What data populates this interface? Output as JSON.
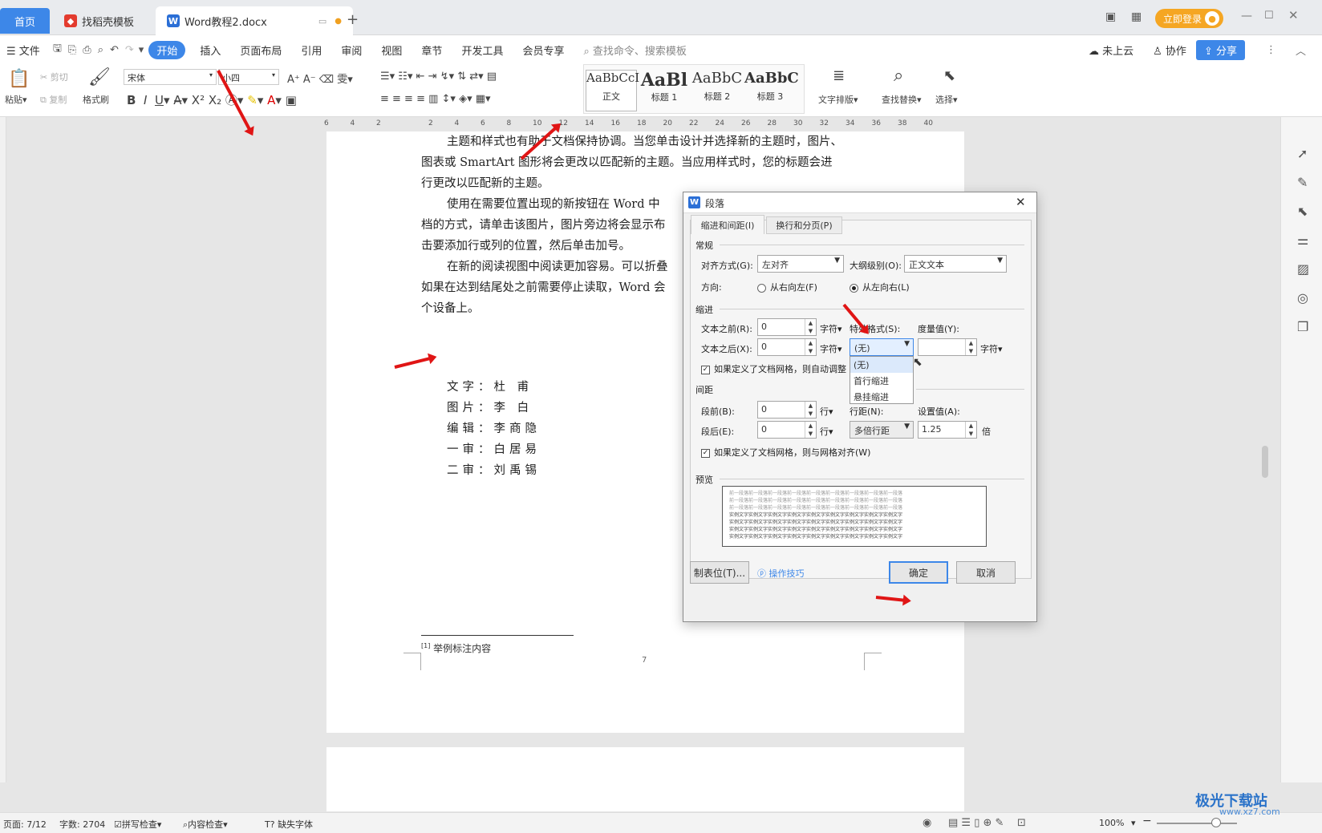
{
  "tabs": {
    "home": "首页",
    "template": "找稻壳模板",
    "document": "Word教程2.docx",
    "add": "+"
  },
  "titlebar": {
    "login": "立即登录"
  },
  "menu": {
    "file": "文件",
    "items": [
      "开始",
      "插入",
      "页面布局",
      "引用",
      "审阅",
      "视图",
      "章节",
      "开发工具",
      "会员专享"
    ],
    "search": "查找命令、搜索模板",
    "cloud": "未上云",
    "collab": "协作",
    "share": "分享"
  },
  "ribbon": {
    "paste": "粘贴",
    "cut": "剪切",
    "copy": "复制",
    "format_painter": "格式刷",
    "font": "宋体",
    "size": "小四",
    "styles": [
      {
        "preview": "AaBbCcI",
        "label": "正文"
      },
      {
        "preview": "AaBl",
        "label": "标题 1"
      },
      {
        "preview": "AaBbC",
        "label": "标题 2"
      },
      {
        "preview": "AaBbC",
        "label": "标题 3"
      }
    ],
    "text_layout": "文字排版",
    "find_replace": "查找替换",
    "select": "选择"
  },
  "ruler_ticks": [
    "6",
    "4",
    "2",
    "",
    "2",
    "4",
    "6",
    "8",
    "10",
    "12",
    "14",
    "16",
    "18",
    "20",
    "22",
    "24",
    "26",
    "28",
    "30",
    "32",
    "34",
    "36",
    "38",
    "40"
  ],
  "document": {
    "lines": [
      "主题和样式也有助于文档保持协调。当您单击设计并选择新的主题时，图片、",
      "图表或 SmartArt 图形将会更改以匹配新的主题。当应用样式时，您的标题会进",
      "行更改以匹配新的主题。",
      "使用在需要位置出现的新按钮在  Word 中",
      "档的方式，请单击该图片，图片旁边将会显示布",
      "击要添加行或列的位置，然后单击加号。",
      "在新的阅读视图中阅读更加容易。可以折叠",
      "如果在达到结尾处之前需要停止读取，Word 会",
      "个设备上。"
    ],
    "credits": [
      "文字：杜  甫",
      "图片：李  白",
      "编辑：李商隐",
      "一审：白居易",
      "二审：刘禹锡"
    ],
    "footnote": "举例标注内容",
    "footnote_mark": "[1]",
    "page_number": "7"
  },
  "dialog": {
    "title": "段落",
    "tabs": [
      "缩进和间距(I)",
      "换行和分页(P)"
    ],
    "general": "常规",
    "alignment_label": "对齐方式(G):",
    "alignment_value": "左对齐",
    "outline_label": "大纲级别(O):",
    "outline_value": "正文文本",
    "direction_label": "方向:",
    "rtl": "从右向左(F)",
    "ltr": "从左向右(L)",
    "indent": "缩进",
    "before_text_label": "文本之前(R):",
    "before_text_value": "0",
    "unit_char": "字符",
    "after_text_label": "文本之后(X):",
    "after_text_value": "0",
    "special_label": "特殊格式(S):",
    "special_value": "(无)",
    "measure_label": "度量值(Y):",
    "measure_value": "",
    "special_options": [
      "(无)",
      "首行缩进",
      "悬挂缩进"
    ],
    "grid_indent_check": "如果定义了文档网格，则自动调整",
    "spacing": "间距",
    "before_label": "段前(B):",
    "before_value": "0",
    "unit_line": "行",
    "after_label": "段后(E):",
    "after_value": "0",
    "line_spacing_label": "行距(N):",
    "line_spacing_value": "多倍行距",
    "set_value_label": "设置值(A):",
    "set_value": "1.25",
    "unit_times": "倍",
    "grid_align_check": "如果定义了文档网格，则与网格对齐(W)",
    "preview": "预览",
    "preview_prev": "前一段落前一段落前一段落前一段落前一段落前一段落前一段落前一段落前一段落",
    "preview_sample": "实例文字实例文字实例文字实例文字实例文字实例文字实例文字实例文字实例文字",
    "tab_stops_btn": "制表位(T)...",
    "tips": "操作技巧",
    "ok": "确定",
    "cancel": "取消"
  },
  "status": {
    "page": "页面: 7/12",
    "words": "字数: 2704",
    "spell": "拼写检查",
    "content_check": "内容检查",
    "missing_font": "缺失字体",
    "zoom": "100%"
  },
  "watermark": {
    "name": "极光下载站",
    "url": "www.xz7.com"
  },
  "colors": {
    "accent": "#3d87e8",
    "login": "#f5a623",
    "arrow": "#e01515"
  }
}
